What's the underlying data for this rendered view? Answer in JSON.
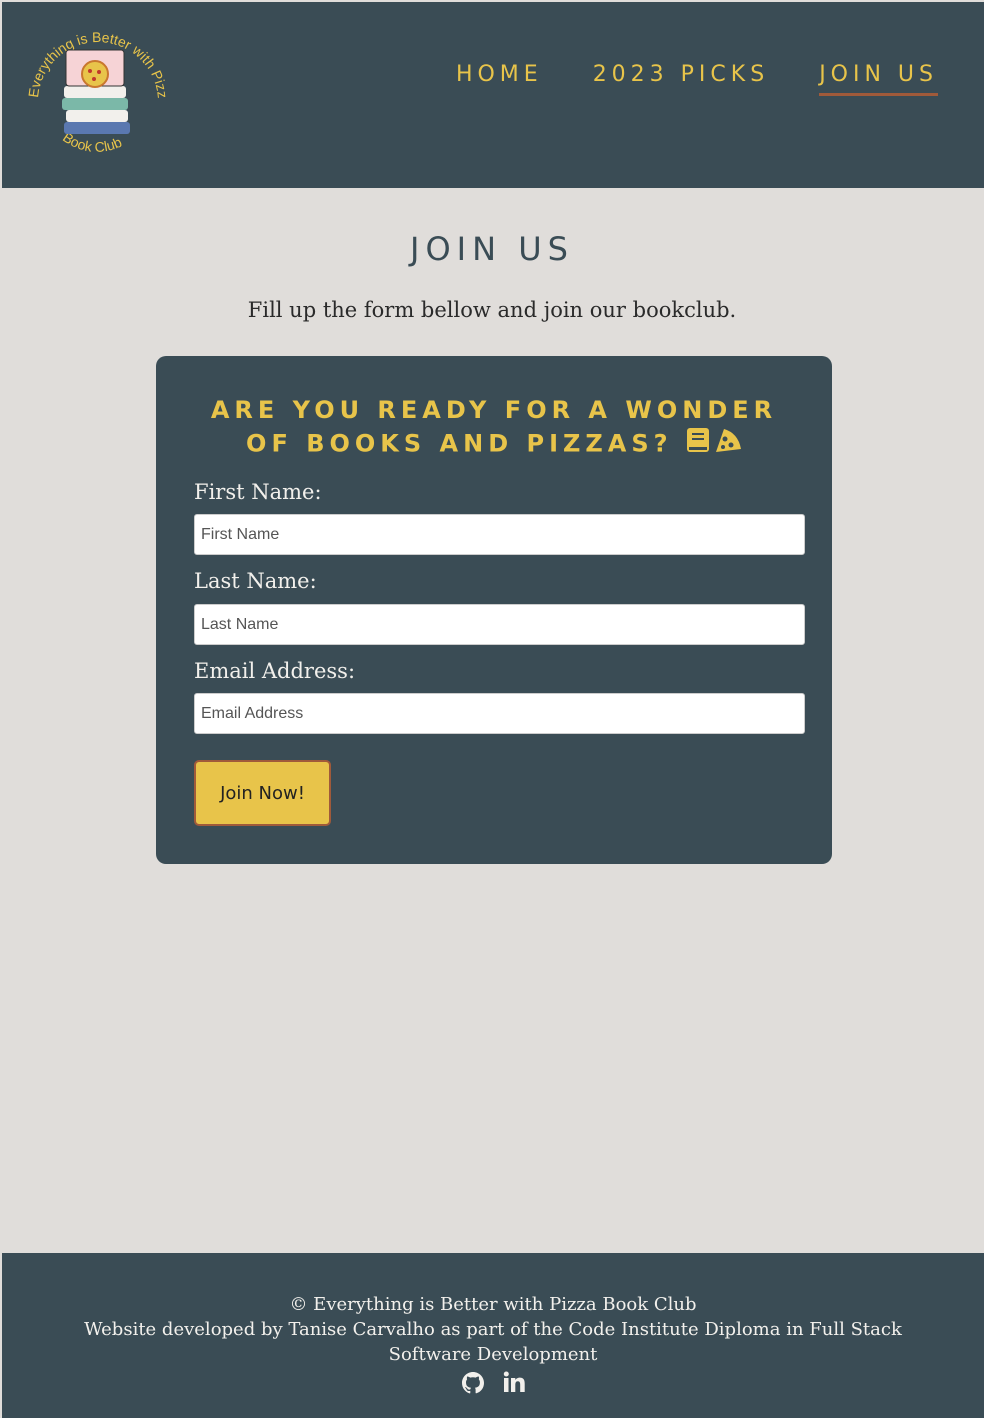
{
  "logo": {
    "circle_text_top": "Everything is Better with Pizza",
    "circle_text_bottom": "Book Club",
    "accent": "#e8c44a"
  },
  "nav": {
    "items": [
      {
        "label": "HOME",
        "active": false
      },
      {
        "label": "2023 PICKS",
        "active": false
      },
      {
        "label": "JOIN US",
        "active": true
      }
    ]
  },
  "main": {
    "title": "JOIN US",
    "intro": "Fill up the form bellow and join our bookclub."
  },
  "form": {
    "heading_line1": "ARE YOU READY FOR A WONDER",
    "heading_line2": "OF BOOKS AND PIZZAS?",
    "heading_icons": [
      "book-icon",
      "pizza-icon"
    ],
    "first_name": {
      "label": "First Name:",
      "placeholder": "First Name"
    },
    "last_name": {
      "label": "Last Name:",
      "placeholder": "Last Name"
    },
    "email": {
      "label": "Email Address:",
      "placeholder": "Email Address"
    },
    "submit_label": "Join Now!"
  },
  "footer": {
    "copyright": "© Everything is Better with Pizza Book Club",
    "credits": "Website developed by Tanise Carvalho as part of the Code Institute Diploma in Full Stack Software Development",
    "social_icons": [
      "github-icon",
      "linkedin-icon"
    ]
  },
  "colors": {
    "primary": "#3a4c55",
    "accent": "#e8c44a",
    "background": "#e0ddda",
    "active_underline": "#a05a3a"
  }
}
